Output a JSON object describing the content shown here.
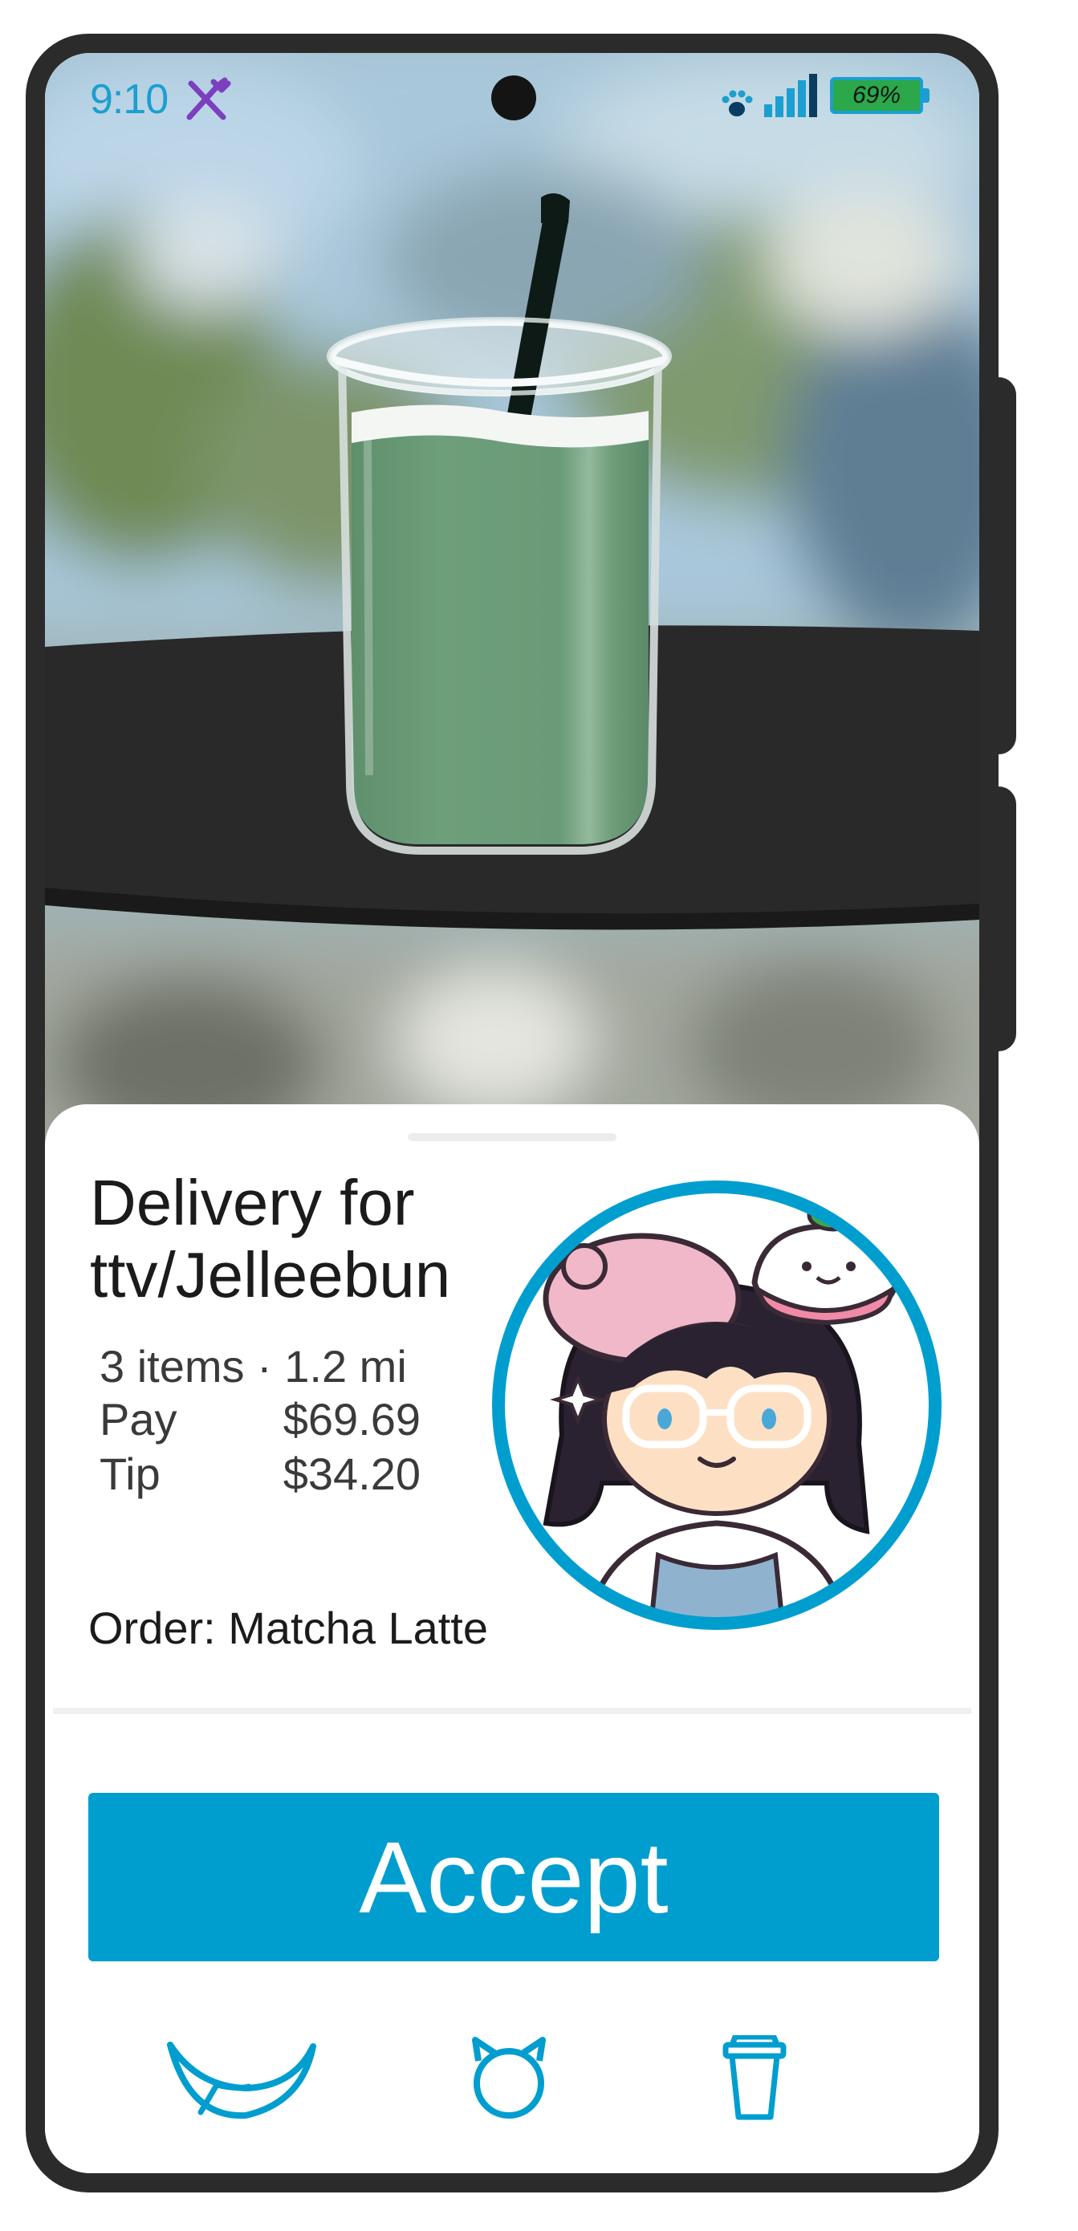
{
  "status_bar": {
    "time": "9:10",
    "battery_label": "69%",
    "battery_level": 0.69,
    "icons": [
      "fork-knife-icon",
      "paw-icon",
      "signal-icon",
      "battery-icon"
    ]
  },
  "hero": {
    "image": "matcha latte in clear cup with black straw on a dark table, blurred background"
  },
  "order_card": {
    "title_line1": "Delivery for",
    "title_line2": "ttv/Jelleebun",
    "summary": "3 items · 1.2 mi",
    "pay_label": "Pay",
    "pay_value": "$69.69",
    "tip_label": "Tip",
    "tip_value": "$34.20",
    "order_text": "Order: Matcha Latte"
  },
  "actions": {
    "accept_label": "Accept"
  },
  "nav": {
    "items": [
      "bow-icon",
      "cat-icon",
      "cup-icon"
    ]
  },
  "colors": {
    "accent": "#009ecf",
    "frame": "#2b2b2b",
    "matcha": "#6e9f7b"
  }
}
